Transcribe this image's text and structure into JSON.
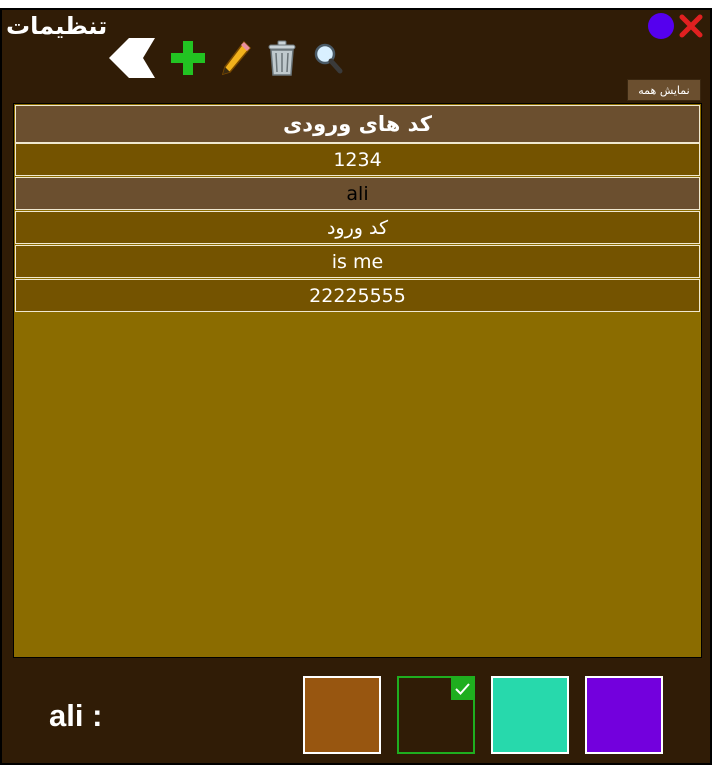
{
  "window": {
    "title": "تنظیمات"
  },
  "toolbar": {
    "icons": [
      "back-arrow-icon",
      "add-icon",
      "edit-pencil-icon",
      "trash-icon",
      "search-icon"
    ]
  },
  "actions": {
    "show_all_label": "نمایش همه"
  },
  "table": {
    "header": "کد های ورودی",
    "rows": [
      "1234",
      "ali",
      "کد ورود",
      "is me",
      "22225555"
    ],
    "selected_row": "ali"
  },
  "footer": {
    "user_label": "ali :",
    "swatches": [
      {
        "color": "#985610",
        "selected": false
      },
      {
        "color": "#301c06",
        "selected": true
      },
      {
        "color": "#27d9ac",
        "selected": false
      },
      {
        "color": "#7300dd",
        "selected": false
      }
    ]
  },
  "colors": {
    "window_bg": "#301c06",
    "grid_bg": "#8b6c00",
    "row_bg": "#745300",
    "header_bg": "#6b4f2f",
    "accent_purple": "#5500ee",
    "close_red": "#e02020",
    "check_green": "#1fae1f"
  }
}
